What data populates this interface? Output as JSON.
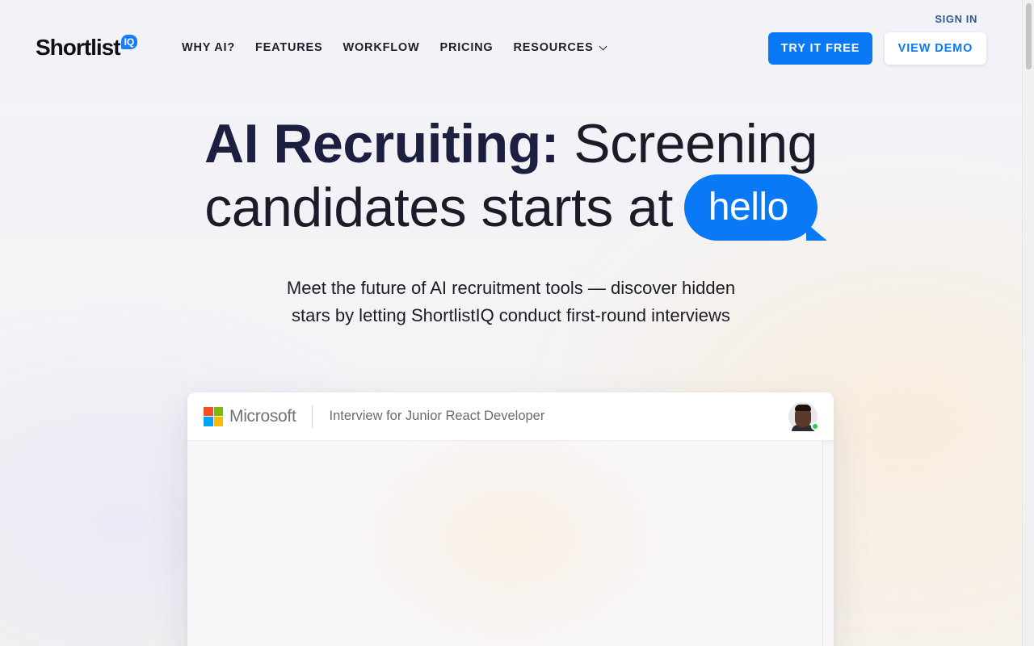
{
  "header": {
    "sign_in": "SIGN IN",
    "logo": {
      "text": "Shortlist",
      "badge": "IQ"
    },
    "nav": [
      {
        "label": "WHY AI?",
        "has_dropdown": false
      },
      {
        "label": "FEATURES",
        "has_dropdown": false
      },
      {
        "label": "WORKFLOW",
        "has_dropdown": false
      },
      {
        "label": "PRICING",
        "has_dropdown": false
      },
      {
        "label": "RESOURCES",
        "has_dropdown": true
      }
    ],
    "try_free": "TRY IT FREE",
    "view_demo": "VIEW DEMO"
  },
  "hero": {
    "title_strong": "AI Recruiting:",
    "title_rest_line1": "Screening",
    "title_line2": "candidates starts at",
    "bubble_word": "hello",
    "subtitle_line1": "Meet the future of AI recruitment tools — discover hidden",
    "subtitle_line2": "stars by letting ShortlistIQ conduct first-round interviews"
  },
  "interview_card": {
    "company": "Microsoft",
    "title": "Interview for Junior React Developer",
    "candidate_status": "online"
  },
  "colors": {
    "accent": "#0a79f5",
    "heading_dark": "#1c1f3f",
    "online_green": "#24d04a",
    "ms_red": "#f25022",
    "ms_green": "#7fba00",
    "ms_blue": "#00a4ef",
    "ms_yellow": "#ffb900"
  }
}
